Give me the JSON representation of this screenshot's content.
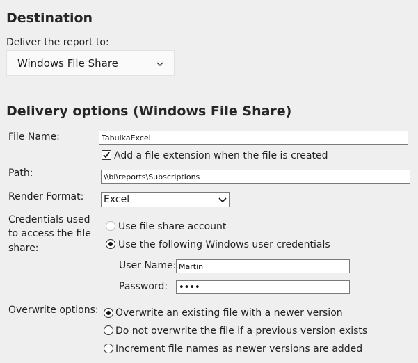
{
  "destination": {
    "heading": "Destination",
    "deliver_label": "Deliver the report to:",
    "deliver_value": "Windows File Share"
  },
  "delivery": {
    "heading": "Delivery options (Windows File Share)",
    "file_name_label": "File Name:",
    "file_name_value": "TabulkaExcel",
    "add_extension_label": "Add a file extension when the file is created",
    "add_extension_checked": true,
    "path_label": "Path:",
    "path_value": "\\\\bi\\reports\\Subscriptions",
    "render_format_label": "Render Format:",
    "render_format_value": "Excel",
    "credentials_label": [
      "Credentials used",
      "to access the file",
      "share:"
    ],
    "cred_option_file_share": "Use file share account",
    "cred_option_windows": "Use the following Windows user credentials",
    "user_name_label": "User Name:",
    "user_name_value": "Martin",
    "password_label": "Password:",
    "password_value": "••••",
    "overwrite_label": "Overwrite options:",
    "overwrite_options": [
      "Overwrite an existing file with a newer version",
      "Do not overwrite the file if a previous version exists",
      "Increment file names as newer versions are added"
    ]
  },
  "icons": {
    "dropdown": "chevron-down-icon",
    "check": "checkmark-icon"
  }
}
